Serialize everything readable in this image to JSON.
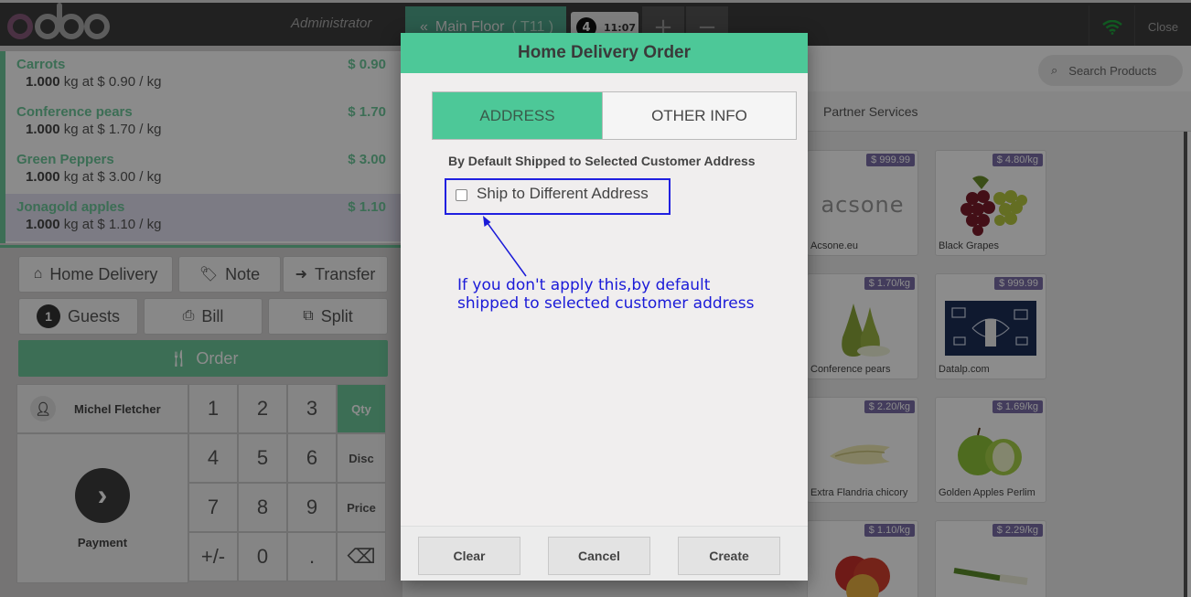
{
  "header": {
    "user": "Administrator",
    "floor_button": "Main Floor",
    "table_label": "( T11 )",
    "order_tab": {
      "number": "4",
      "time": "11:07"
    },
    "plus": "+",
    "minus": "−",
    "close": "Close"
  },
  "orderlines": [
    {
      "name": "Carrots",
      "price": "$ 0.90",
      "qty": "1.000",
      "detail": "kg at $ 0.90 / kg"
    },
    {
      "name": "Conference pears",
      "price": "$ 1.70",
      "qty": "1.000",
      "detail": "kg at $ 1.70 / kg"
    },
    {
      "name": "Green Peppers",
      "price": "$ 3.00",
      "qty": "1.000",
      "detail": "kg at $ 3.00 / kg"
    },
    {
      "name": "Jonagold apples",
      "price": "$ 1.10",
      "qty": "1.000",
      "detail": "kg at $ 1.10 / kg",
      "selected": true
    }
  ],
  "controls": {
    "home_delivery": "Home Delivery",
    "note": "Note",
    "transfer": "Transfer",
    "guests_count": "1",
    "guests": "Guests",
    "bill": "Bill",
    "split": "Split",
    "order": "Order"
  },
  "numpad": {
    "customer": "Michel Fletcher",
    "payment": "Payment",
    "keys": [
      "1",
      "2",
      "3",
      "4",
      "5",
      "6",
      "7",
      "8",
      "9",
      "+/-",
      "0",
      "."
    ],
    "modes": [
      "Qty",
      "Disc",
      "Price"
    ],
    "active_mode": "Qty"
  },
  "products_pane": {
    "search_placeholder": "Search Products",
    "category": "Partner Services",
    "items": [
      {
        "name": "Acsone.eu",
        "price": "$ 999.99",
        "logo_text": "acsone"
      },
      {
        "name": "Black Grapes",
        "price": "$ 4.80/kg"
      },
      {
        "name": "Conference pears",
        "price": "$ 1.70/kg"
      },
      {
        "name": "Datalp.com",
        "price": "$ 999.99"
      },
      {
        "name": "Extra Flandria chicory",
        "price": "$ 2.20/kg"
      },
      {
        "name": "Golden Apples Perlim",
        "price": "$ 1.69/kg"
      },
      {
        "name": "",
        "price": "$ 1.10/kg"
      },
      {
        "name": "",
        "price": "$ 2.29/kg"
      }
    ]
  },
  "modal": {
    "title": "Home Delivery Order",
    "tab_address": "ADDRESS",
    "tab_other": "OTHER INFO",
    "default_note": "By Default Shipped to Selected Customer Address",
    "checkbox_label": "Ship to Different Address",
    "checkbox_checked": false,
    "annotation_line1": "If you don't apply this,by default",
    "annotation_line2": "shipped to selected customer address",
    "buttons": {
      "clear": "Clear",
      "cancel": "Cancel",
      "create": "Create"
    }
  },
  "colors": {
    "accent": "#6ec89b",
    "modal_header": "#4dc898",
    "annotation": "#1a1ad8",
    "header_bg": "#3c3c3c",
    "price_tag": "#7a6ea8"
  }
}
